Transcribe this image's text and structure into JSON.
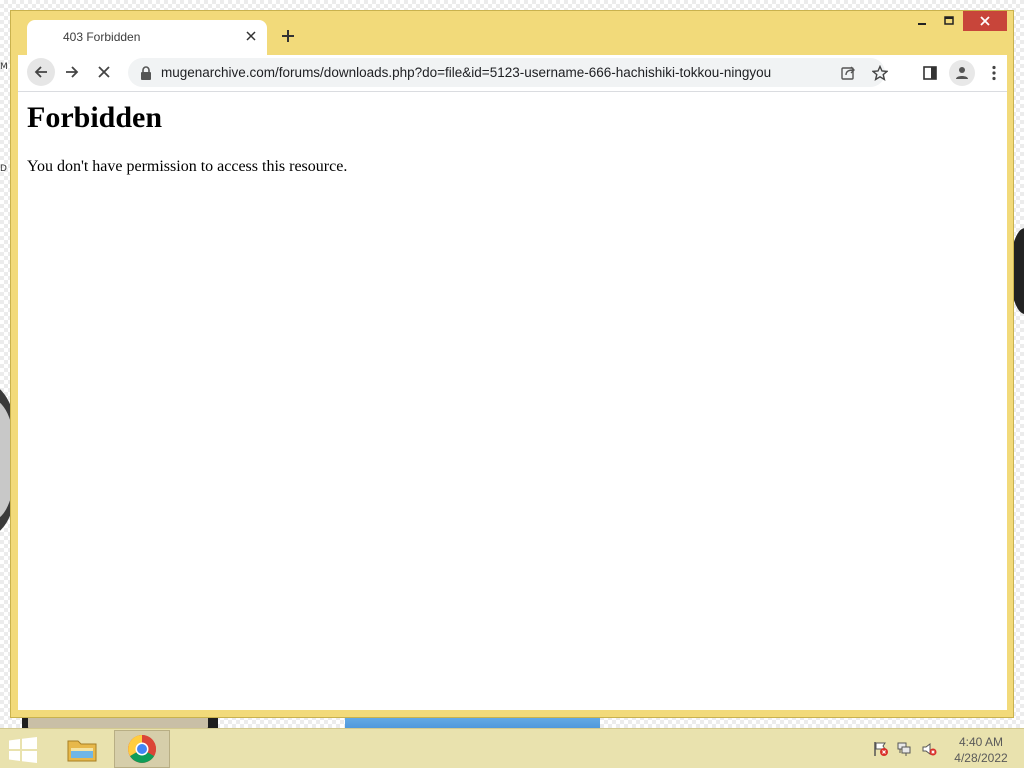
{
  "desktop": {
    "fragment_top": "M",
    "fragment_mid": "D"
  },
  "browser": {
    "tab_title": "403 Forbidden",
    "url": "mugenarchive.com/forums/downloads.php?do=file&id=5123-username-666-hachishiki-tokkou-ningyou",
    "theme_color": "#f2da7a"
  },
  "page": {
    "heading": "Forbidden",
    "message": "You don't have permission to access this resource."
  },
  "taskbar": {
    "time": "4:40 AM",
    "date": "4/28/2022"
  }
}
